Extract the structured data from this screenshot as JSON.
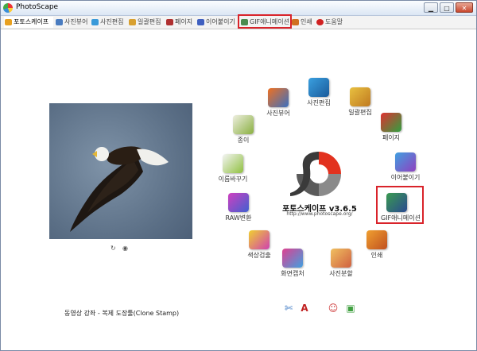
{
  "window": {
    "title": "PhotoScape"
  },
  "tabs": [
    {
      "label": "포토스케이프",
      "icon": "photoscape-icon",
      "color": "#e8a020"
    },
    {
      "label": "사진뷰어",
      "icon": "viewer-icon",
      "color": "#4a7cc0"
    },
    {
      "label": "사진편집",
      "icon": "editor-icon",
      "color": "#3a9ad9"
    },
    {
      "label": "일괄편집",
      "icon": "batch-icon",
      "color": "#d8a030"
    },
    {
      "label": "페이지",
      "icon": "page-icon",
      "color": "#b03030"
    },
    {
      "label": "이어붙이기",
      "icon": "combine-icon",
      "color": "#4060c0"
    },
    {
      "label": "GIF애니메이션",
      "icon": "gif-icon",
      "color": "#4a8a50"
    },
    {
      "label": "인쇄",
      "icon": "print-icon",
      "color": "#d07020"
    },
    {
      "label": "도움말",
      "icon": "help-icon",
      "color": "#d02020"
    }
  ],
  "nodes": {
    "viewer": "사진뷰어",
    "editor": "사진편집",
    "batch": "일괄편집",
    "page": "페이지",
    "combine": "이어붙이기",
    "gif": "GIF애니메이션",
    "print": "인쇄",
    "splitter": "사진분할",
    "screencapture": "화면캡처",
    "colorpicker": "색상검출",
    "raw": "RAW변환",
    "rename": "이름바꾸기",
    "paper": "종이"
  },
  "logo": {
    "name": "포토스케이프 v3.6.5",
    "url": "http://www.photoscape.org/"
  },
  "status": {
    "text": "동영상 강좌 - 복제 도장툴(Clone Stamp)"
  },
  "colors": {
    "highlight": "#d9232a",
    "logo_red": "#e2321f",
    "logo_gray": "#8a8a8a"
  }
}
